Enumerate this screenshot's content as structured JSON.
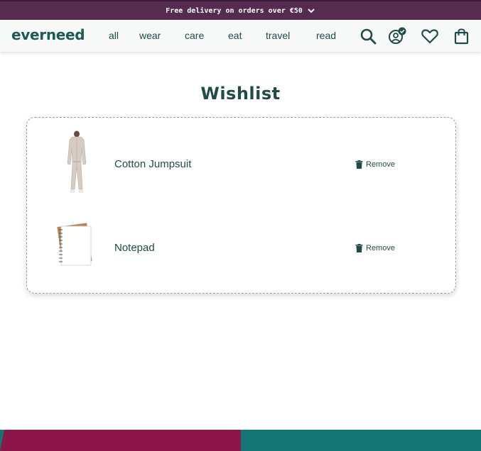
{
  "promo": {
    "text": "Free delivery on orders over €50"
  },
  "brand": {
    "logo": "everneed"
  },
  "nav": {
    "links": [
      "all",
      "wear",
      "care",
      "eat",
      "travel",
      "read"
    ],
    "icons": [
      "search-icon",
      "account-verified-icon",
      "heart-icon",
      "shopping-bag-icon"
    ]
  },
  "page": {
    "title": "Wishlist"
  },
  "wishlist": {
    "items": [
      {
        "name": "Cotton Jumpsuit",
        "remove_label": "Remove",
        "image": "jumpsuit-image"
      },
      {
        "name": "Notepad",
        "remove_label": "Remove",
        "image": "notepad-image"
      }
    ]
  },
  "colors": {
    "promo_bg": "#552b4f",
    "brand": "#1d5a55",
    "text": "#1f4b49",
    "footer_magenta": "#8c164a",
    "footer_teal": "#137674"
  }
}
